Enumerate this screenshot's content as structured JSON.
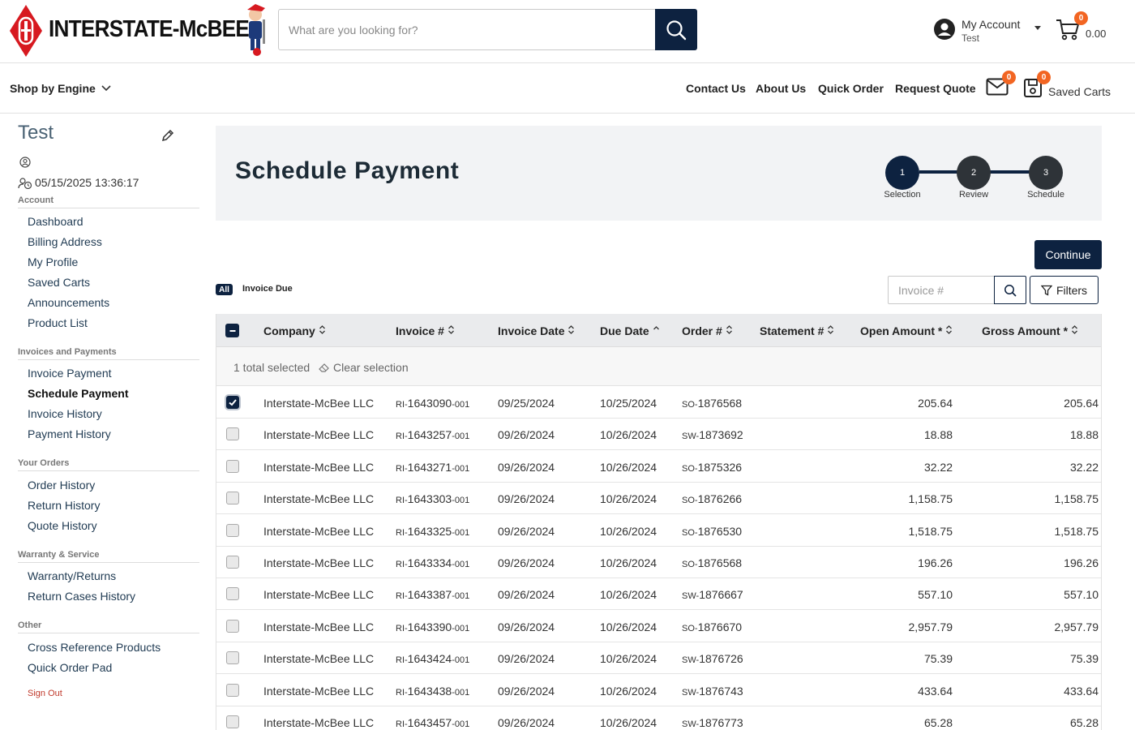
{
  "header": {
    "brand": "INTERSTATE-McBEE",
    "search_placeholder": "What are you looking for?",
    "account_title": "My Account",
    "account_name": "Test",
    "cart_count": "0",
    "cart_total": "0.00"
  },
  "nav": {
    "shop_by_engine": "Shop by Engine",
    "links": [
      "Contact Us",
      "About Us",
      "Quick Order",
      "Request Quote"
    ],
    "mail_count": "0",
    "saved_carts_count": "0",
    "saved_carts_label": "Saved Carts"
  },
  "sidebar": {
    "user_name": "Test",
    "timestamp": "05/15/2025 13:36:17",
    "sections": [
      {
        "title": "Account",
        "items": [
          "Dashboard",
          "Billing Address",
          "My Profile",
          "Saved Carts",
          "Announcements",
          "Product List"
        ]
      },
      {
        "title": "Invoices and Payments",
        "items": [
          "Invoice Payment",
          "Schedule Payment",
          "Invoice History",
          "Payment History"
        ]
      },
      {
        "title": "Your Orders",
        "items": [
          "Order History",
          "Return History",
          "Quote History"
        ]
      },
      {
        "title": "Warranty & Service",
        "items": [
          "Warranty/Returns",
          "Return Cases History"
        ]
      },
      {
        "title": "Other",
        "items": [
          "Cross Reference Products",
          "Quick Order Pad"
        ]
      }
    ],
    "active_item": "Schedule Payment",
    "sign_out": "Sign Out"
  },
  "main": {
    "title": "Schedule Payment",
    "steps": [
      {
        "num": "1",
        "label": "Selection"
      },
      {
        "num": "2",
        "label": "Review"
      },
      {
        "num": "3",
        "label": "Schedule"
      }
    ],
    "continue_label": "Continue",
    "chips": {
      "all": "All",
      "invoice_due": "Invoice Due"
    },
    "invoice_search_placeholder": "Invoice #",
    "filters_label": "Filters",
    "selection_text": "1 total selected",
    "clear_selection": "Clear selection",
    "colors": {
      "primary": "#0d2240",
      "accent": "#f26522"
    }
  },
  "table": {
    "columns": [
      "Company",
      "Invoice #",
      "Invoice Date",
      "Due Date",
      "Order #",
      "Statement #",
      "Open Amount *",
      "Gross Amount *"
    ],
    "rows": [
      {
        "checked": true,
        "company": "Interstate-McBee LLC",
        "inv_prefix": "RI-",
        "inv_num": "1643090",
        "inv_suffix": "-001",
        "invoice_date": "09/25/2024",
        "due_date": "10/25/2024",
        "ord_prefix": "SO-",
        "ord_num": "1876568",
        "statement": "",
        "open": "205.64",
        "gross": "205.64"
      },
      {
        "checked": false,
        "company": "Interstate-McBee LLC",
        "inv_prefix": "RI-",
        "inv_num": "1643257",
        "inv_suffix": "-001",
        "invoice_date": "09/26/2024",
        "due_date": "10/26/2024",
        "ord_prefix": "SW-",
        "ord_num": "1873692",
        "statement": "",
        "open": "18.88",
        "gross": "18.88"
      },
      {
        "checked": false,
        "company": "Interstate-McBee LLC",
        "inv_prefix": "RI-",
        "inv_num": "1643271",
        "inv_suffix": "-001",
        "invoice_date": "09/26/2024",
        "due_date": "10/26/2024",
        "ord_prefix": "SO-",
        "ord_num": "1875326",
        "statement": "",
        "open": "32.22",
        "gross": "32.22"
      },
      {
        "checked": false,
        "company": "Interstate-McBee LLC",
        "inv_prefix": "RI-",
        "inv_num": "1643303",
        "inv_suffix": "-001",
        "invoice_date": "09/26/2024",
        "due_date": "10/26/2024",
        "ord_prefix": "SO-",
        "ord_num": "1876266",
        "statement": "",
        "open": "1,158.75",
        "gross": "1,158.75"
      },
      {
        "checked": false,
        "company": "Interstate-McBee LLC",
        "inv_prefix": "RI-",
        "inv_num": "1643325",
        "inv_suffix": "-001",
        "invoice_date": "09/26/2024",
        "due_date": "10/26/2024",
        "ord_prefix": "SO-",
        "ord_num": "1876530",
        "statement": "",
        "open": "1,518.75",
        "gross": "1,518.75"
      },
      {
        "checked": false,
        "company": "Interstate-McBee LLC",
        "inv_prefix": "RI-",
        "inv_num": "1643334",
        "inv_suffix": "-001",
        "invoice_date": "09/26/2024",
        "due_date": "10/26/2024",
        "ord_prefix": "SO-",
        "ord_num": "1876568",
        "statement": "",
        "open": "196.26",
        "gross": "196.26"
      },
      {
        "checked": false,
        "company": "Interstate-McBee LLC",
        "inv_prefix": "RI-",
        "inv_num": "1643387",
        "inv_suffix": "-001",
        "invoice_date": "09/26/2024",
        "due_date": "10/26/2024",
        "ord_prefix": "SW-",
        "ord_num": "1876667",
        "statement": "",
        "open": "557.10",
        "gross": "557.10"
      },
      {
        "checked": false,
        "company": "Interstate-McBee LLC",
        "inv_prefix": "RI-",
        "inv_num": "1643390",
        "inv_suffix": "-001",
        "invoice_date": "09/26/2024",
        "due_date": "10/26/2024",
        "ord_prefix": "SO-",
        "ord_num": "1876670",
        "statement": "",
        "open": "2,957.79",
        "gross": "2,957.79"
      },
      {
        "checked": false,
        "company": "Interstate-McBee LLC",
        "inv_prefix": "RI-",
        "inv_num": "1643424",
        "inv_suffix": "-001",
        "invoice_date": "09/26/2024",
        "due_date": "10/26/2024",
        "ord_prefix": "SW-",
        "ord_num": "1876726",
        "statement": "",
        "open": "75.39",
        "gross": "75.39"
      },
      {
        "checked": false,
        "company": "Interstate-McBee LLC",
        "inv_prefix": "RI-",
        "inv_num": "1643438",
        "inv_suffix": "-001",
        "invoice_date": "09/26/2024",
        "due_date": "10/26/2024",
        "ord_prefix": "SW-",
        "ord_num": "1876743",
        "statement": "",
        "open": "433.64",
        "gross": "433.64"
      },
      {
        "checked": false,
        "company": "Interstate-McBee LLC",
        "inv_prefix": "RI-",
        "inv_num": "1643457",
        "inv_suffix": "-001",
        "invoice_date": "09/26/2024",
        "due_date": "10/26/2024",
        "ord_prefix": "SW-",
        "ord_num": "1876773",
        "statement": "",
        "open": "65.28",
        "gross": "65.28"
      }
    ]
  }
}
